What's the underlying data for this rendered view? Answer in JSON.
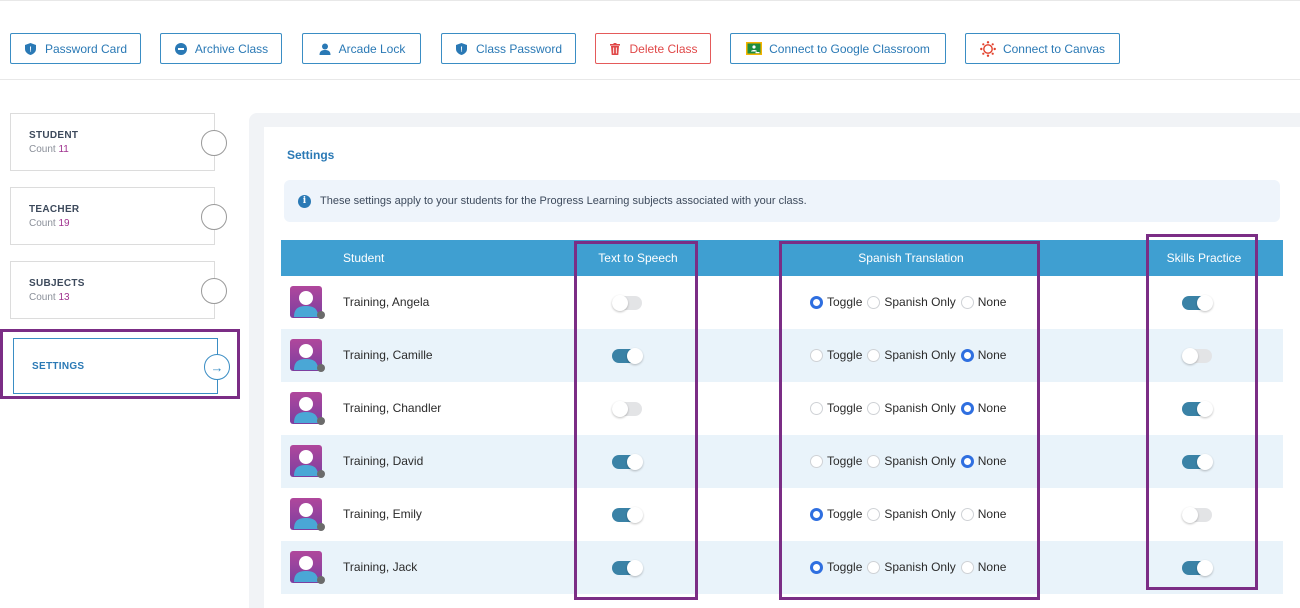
{
  "toolbar": {
    "buttons": [
      {
        "label": "Password Card",
        "icon": "shield-icon"
      },
      {
        "label": "Archive Class",
        "icon": "minus-circle-icon"
      },
      {
        "label": "Arcade Lock",
        "icon": "user-icon"
      },
      {
        "label": "Class Password",
        "icon": "shield-icon"
      },
      {
        "label": "Delete Class",
        "icon": "trash-icon"
      },
      {
        "label": "Connect to Google Classroom",
        "icon": "google-classroom-icon"
      },
      {
        "label": "Connect to Canvas",
        "icon": "canvas-icon"
      }
    ]
  },
  "nav": {
    "student": {
      "title": "STUDENT",
      "count_label": "Count",
      "count": "11"
    },
    "teacher": {
      "title": "TEACHER",
      "count_label": "Count",
      "count": "19"
    },
    "subjects": {
      "title": "SUBJECTS",
      "count_label": "Count",
      "count": "13"
    },
    "settings": {
      "title": "SETTINGS"
    }
  },
  "settings": {
    "title": "Settings",
    "info": "These settings apply to your students for the Progress Learning subjects associated with your class."
  },
  "table": {
    "headers": {
      "student": "Student",
      "tts": "Text to Speech",
      "spanish": "Spanish Translation",
      "skills": "Skills Practice"
    },
    "radio_labels": {
      "toggle": "Toggle",
      "spanish_only": "Spanish Only",
      "none": "None"
    },
    "rows": [
      {
        "name": "Training, Angela",
        "tts": false,
        "spanish": "toggle",
        "skills": true
      },
      {
        "name": "Training, Camille",
        "tts": true,
        "spanish": "none",
        "skills": false
      },
      {
        "name": "Training, Chandler",
        "tts": false,
        "spanish": "none",
        "skills": true
      },
      {
        "name": "Training, David",
        "tts": true,
        "spanish": "none",
        "skills": true
      },
      {
        "name": "Training, Emily",
        "tts": true,
        "spanish": "toggle",
        "skills": false
      },
      {
        "name": "Training, Jack",
        "tts": true,
        "spanish": "toggle",
        "skills": true
      }
    ]
  },
  "colors": {
    "accent": "#2a79b5",
    "header_bg": "#3f9fd1",
    "highlight": "#7b2d85",
    "danger": "#e04848",
    "toggle_on": "#3a82a6"
  }
}
